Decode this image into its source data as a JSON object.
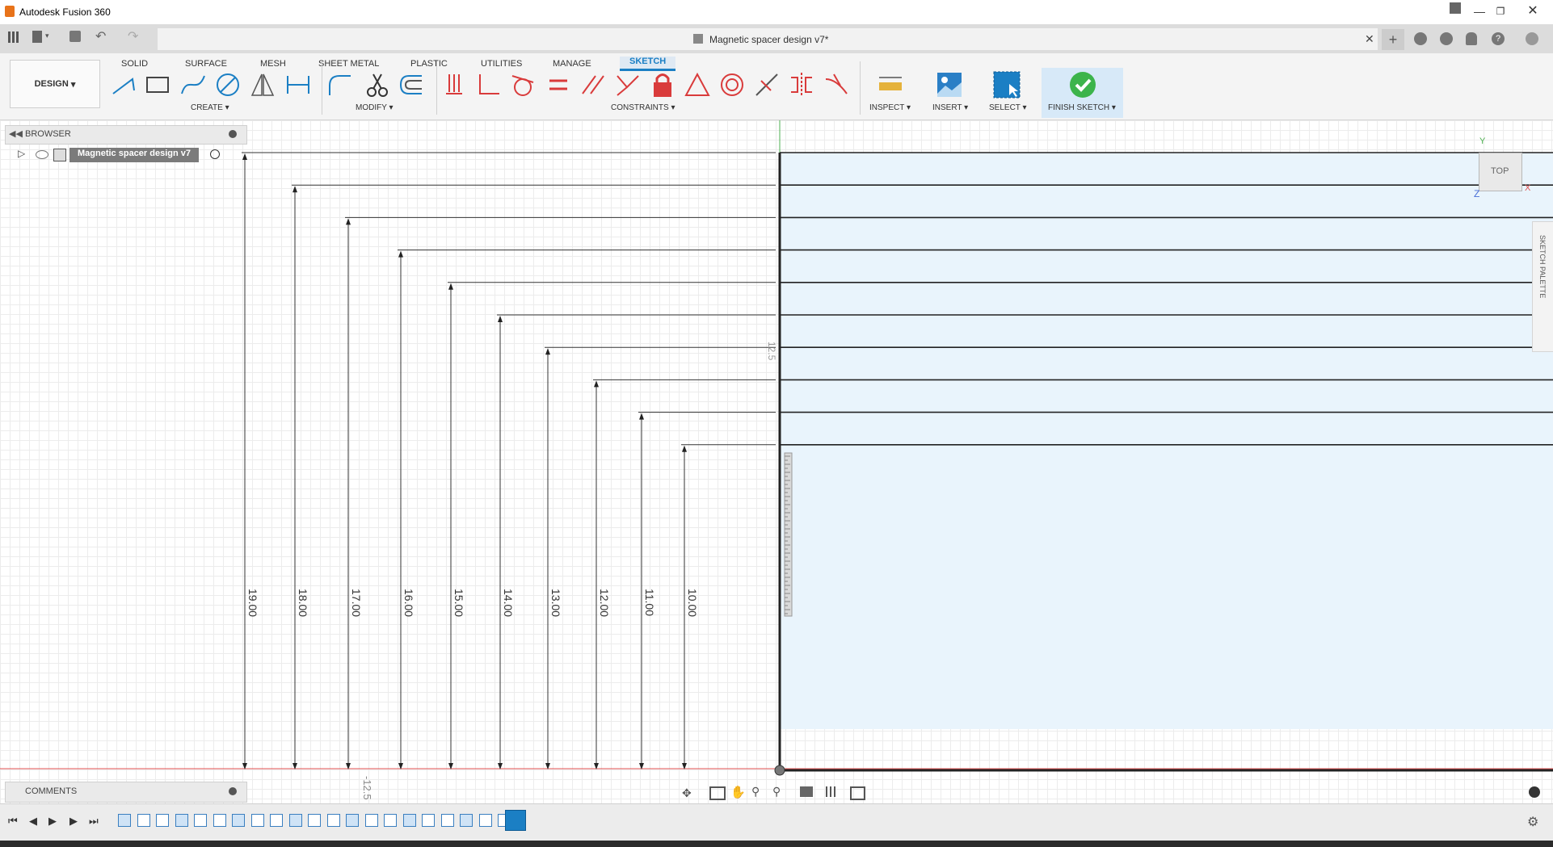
{
  "window": {
    "app_title": "Autodesk Fusion 360",
    "document_title": "Magnetic spacer design v7*"
  },
  "ribbon": {
    "workspace": "DESIGN",
    "tabs": [
      "SOLID",
      "SURFACE",
      "MESH",
      "SHEET METAL",
      "PLASTIC",
      "UTILITIES",
      "MANAGE",
      "SKETCH"
    ],
    "active_tab": "SKETCH",
    "groups": {
      "create": "CREATE",
      "modify": "MODIFY",
      "constraints": "CONSTRAINTS",
      "inspect": "INSPECT",
      "insert": "INSERT",
      "select": "SELECT",
      "finish": "FINISH SKETCH"
    }
  },
  "browser": {
    "header": "BROWSER",
    "root_item": "Magnetic spacer design v7"
  },
  "comments": {
    "header": "COMMENTS"
  },
  "viewcube": {
    "face": "TOP",
    "axis_y": "Y",
    "axis_x": "X",
    "axis_z": "Z"
  },
  "sketch_palette": {
    "label": "SKETCH PALETTE"
  },
  "canvas": {
    "dimensions": [
      "19.00",
      "18.00",
      "17.00",
      "16.00",
      "15.00",
      "14.00",
      "13.00",
      "12.00",
      "11.00",
      "10.00"
    ],
    "ruler_label_vertical": "12.5",
    "ruler_label_horizontal": "-12.5"
  },
  "colors": {
    "active_tab": "#1b7fc4",
    "sketch_fill": "#e9f4fc",
    "finish_check": "#3cb44b",
    "origin_red": "#e05050",
    "origin_green": "#4caf50"
  }
}
